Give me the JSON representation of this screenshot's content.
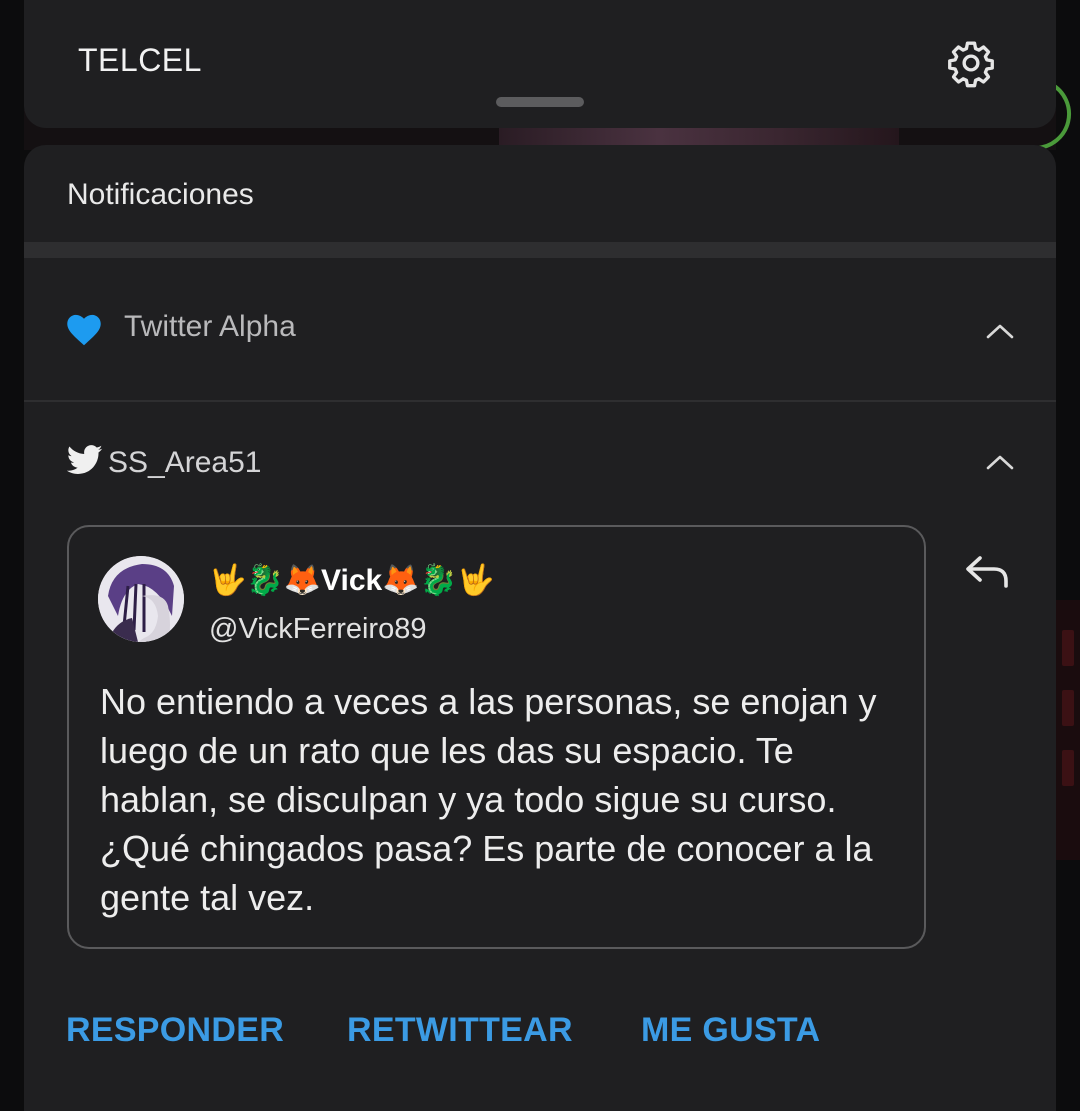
{
  "status": {
    "carrier": "TELCEL"
  },
  "panel": {
    "title": "Notificaciones"
  },
  "group": {
    "app_name": "Twitter Alpha"
  },
  "notification": {
    "account": "SS_Area51",
    "tweet": {
      "display_name": "🤟🐉🦊Vick🦊🐉🤟",
      "handle": "@VickFerreiro89",
      "text": "No entiendo a veces a las personas, se enojan y luego de un rato que les das su espacio. Te hablan, se disculpan y ya todo sigue su curso. ¿Qué chingados pasa? Es parte de conocer a la gente tal vez."
    },
    "actions": {
      "reply": "RESPONDER",
      "retweet": "RETWITTEAR",
      "like": "ME GUSTA"
    }
  },
  "colors": {
    "accent": "#3b9be4",
    "panel_bg": "#1f1f21",
    "heart": "#1d9bf0"
  },
  "icons": {
    "settings": "gear-icon",
    "app": "heart-icon",
    "twitter": "twitter-bird-icon",
    "reply": "reply-arrow-icon",
    "collapse": "chevron-up-icon"
  }
}
